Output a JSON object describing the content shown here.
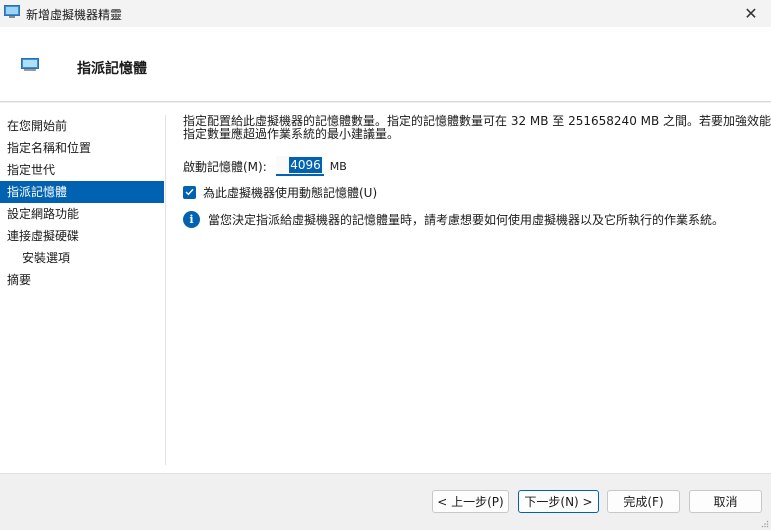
{
  "window": {
    "title": "新增虛擬機器精靈",
    "close_glyph": "✕"
  },
  "header": {
    "title": "指派記憶體"
  },
  "sidebar": {
    "items": [
      {
        "label": "在您開始前"
      },
      {
        "label": "指定名稱和位置"
      },
      {
        "label": "指定世代"
      },
      {
        "label": "指派記憶體"
      },
      {
        "label": "設定網路功能"
      },
      {
        "label": "連接虛擬硬碟"
      },
      {
        "label": "安裝選項"
      },
      {
        "label": "摘要"
      }
    ]
  },
  "main": {
    "description_line1": "指定配置給此虛擬機器的記憶體數量。指定的記憶體數量可在 32 MB 至 251658240 MB 之間。若要加強效能，",
    "description_line2": "指定數量應超過作業系統的最小建議量。",
    "startup_memory_label": "啟動記憶體(M):",
    "startup_memory_value": "4096",
    "startup_memory_unit": "MB",
    "dynamic_memory_label": "為此虛擬機器使用動態記憶體(U)",
    "dynamic_memory_checked": true,
    "info_text": "當您決定指派給虛擬機器的記憶體量時，請考慮想要如何使用虛擬機器以及它所執行的作業系統。",
    "info_glyph": "i"
  },
  "footer": {
    "prev_label": "< 上一步(P)",
    "next_label": "下一步(N) >",
    "finish_label": "完成(F)",
    "cancel_label": "取消"
  },
  "colors": {
    "accent": "#0062b1",
    "header_bg": "#ffffff",
    "window_bg": "#f0f0f0"
  }
}
